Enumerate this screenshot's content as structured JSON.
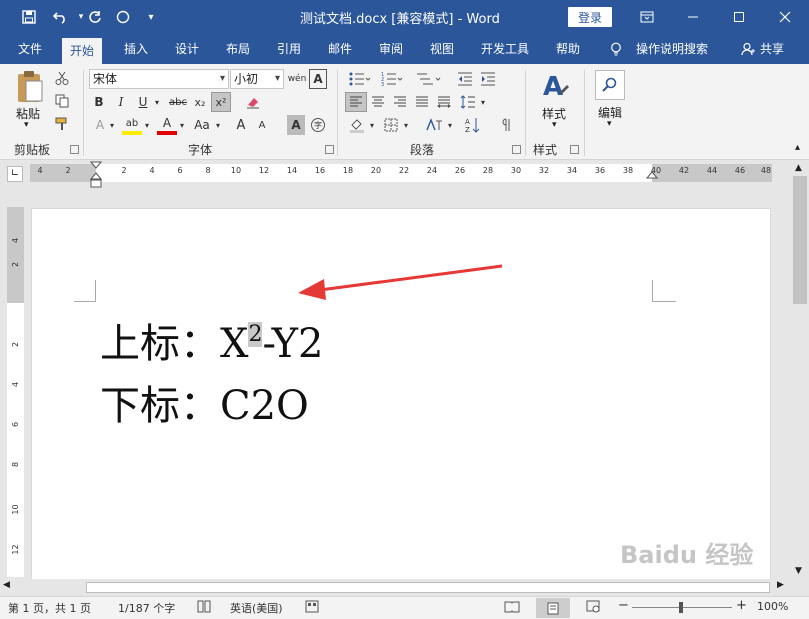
{
  "titlebar": {
    "doc_title": "测试文档.docx [兼容模式]  -  Word",
    "signin": "登录",
    "save_icon": "save-icon",
    "undo_icon": "undo-icon",
    "redo_icon": "redo-icon",
    "touch_icon": "touch-mode-icon",
    "customize_icon": "customize-qat-icon"
  },
  "tabs": [
    {
      "label": "文件"
    },
    {
      "label": "开始"
    },
    {
      "label": "插入"
    },
    {
      "label": "设计"
    },
    {
      "label": "布局"
    },
    {
      "label": "引用"
    },
    {
      "label": "邮件"
    },
    {
      "label": "审阅"
    },
    {
      "label": "视图"
    },
    {
      "label": "开发工具"
    },
    {
      "label": "帮助"
    },
    {
      "label": "操作说明搜索"
    },
    {
      "label": "共享"
    }
  ],
  "ribbon": {
    "clipboard": {
      "paste": "粘贴",
      "label": "剪贴板"
    },
    "font": {
      "font_name": "宋体",
      "font_size": "小初",
      "bold": "B",
      "italic": "I",
      "underline": "U",
      "strike": "abc",
      "subscript": "x₂",
      "superscript": "x²",
      "grow": "A",
      "shrink": "A",
      "case": "Aa",
      "label": "字体"
    },
    "paragraph": {
      "label": "段落"
    },
    "styles": {
      "button": "样式",
      "label": "样式"
    },
    "editing": {
      "button": "编辑"
    }
  },
  "ruler": {
    "ticks": [
      "4",
      "2",
      "2",
      "4",
      "6",
      "8",
      "10",
      "12",
      "14",
      "16",
      "18",
      "20",
      "22",
      "24",
      "26",
      "28",
      "30",
      "32",
      "34",
      "36",
      "38",
      "40",
      "42",
      "44",
      "46",
      "48"
    ],
    "vticks": [
      "4",
      "2",
      "2",
      "4",
      "6",
      "8",
      "10",
      "12"
    ]
  },
  "document": {
    "line1_prefix": "上标：X",
    "line1_sup": "2",
    "line1_suffix": "-Y2",
    "line2": "下标：C2O"
  },
  "statusbar": {
    "page": "第 1 页，共 1 页",
    "words": "1/187 个字",
    "language": "英语(美国)",
    "zoom": "100%"
  },
  "watermark": "Baidu 经验",
  "colors": {
    "brand": "#2b579a",
    "arrow": "#e53935",
    "ribbon": "#f3f3f3"
  }
}
